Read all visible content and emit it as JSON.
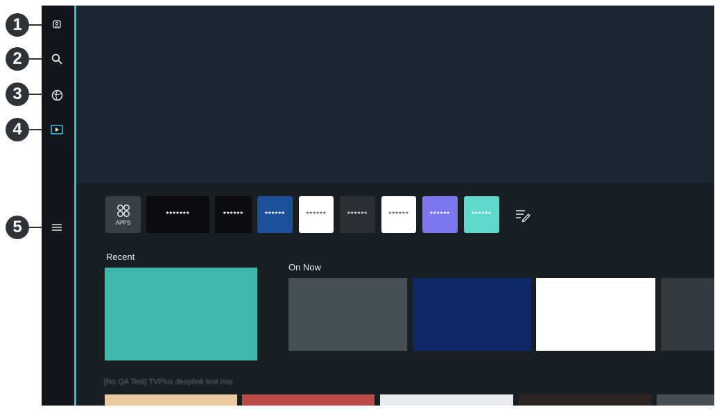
{
  "callouts": [
    "1",
    "2",
    "3",
    "4",
    "5"
  ],
  "sidebar": {
    "icons": [
      "account-icon",
      "search-icon",
      "ambient-icon",
      "media-icon",
      "menu-icon"
    ]
  },
  "apps_row": {
    "apps_label": "APPS",
    "app_tiles": [
      {
        "label": "*******",
        "bg": "#0b0b0d",
        "fg": "#ffffff"
      },
      {
        "label": "******",
        "bg": "#0b0b0d",
        "fg": "#ffffff"
      },
      {
        "label": "******",
        "bg": "#1d4f9a",
        "fg": "#ffffff"
      },
      {
        "label": "******",
        "bg": "#ffffff",
        "fg": "#6b6b6b"
      },
      {
        "label": "******",
        "bg": "#2b2e33",
        "fg": "#d8d8d8"
      },
      {
        "label": "******",
        "bg": "#ffffff",
        "fg": "#6b6b6b"
      },
      {
        "label": "******",
        "bg": "#7b76ee",
        "fg": "#ffffff"
      },
      {
        "label": "******",
        "bg": "#5fd8cc",
        "fg": "#ffffff"
      }
    ],
    "edit_icon": "edit-list-icon"
  },
  "recent": {
    "title": "Recent",
    "card_color": "#3fb8ac"
  },
  "on_now": {
    "title": "On Now",
    "cards": [
      "#475052",
      "#0e2766",
      "#ffffff",
      "#33393d"
    ]
  },
  "bottom_row": {
    "title": "[No QA Test] TVPlus deeplink test row",
    "cards": [
      "#e9c9a1",
      "#b94c48",
      "#e8eaee",
      "#2c2424",
      "#474d51"
    ]
  }
}
